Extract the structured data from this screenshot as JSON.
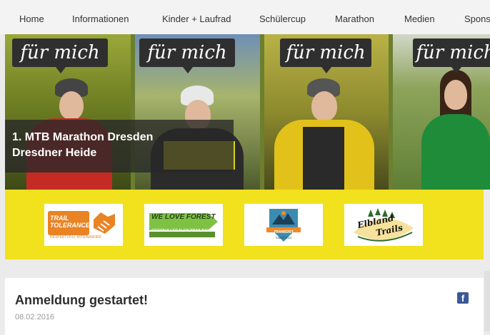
{
  "nav": {
    "items": [
      "Home",
      "Informationen",
      "Kinder + Laufrad",
      "Schülercup",
      "Marathon",
      "Medien",
      "Sponsoren"
    ]
  },
  "hero": {
    "bubble_text": "für mich",
    "caption_line1": "1. MTB Marathon Dresden",
    "caption_line2": "Dresdner Heide"
  },
  "sponsors": {
    "logos": [
      {
        "name": "trail-tolerance-logo",
        "line1": "TRAIL",
        "line2": "TOLERANCE",
        "line3": "RESPEKTVOLL MITEINANDER"
      },
      {
        "name": "we-love-forest-logo",
        "line1": "WE LOVE FOREST",
        "line2": "GEGEN ILLEGALEN TRAILBAU"
      },
      {
        "name": "transost-logo",
        "line1": "TRANSOST",
        "line2": "SINCE 2003"
      },
      {
        "name": "elbland-trails-logo",
        "line1": "Elbland",
        "line2": "Trails"
      }
    ]
  },
  "article": {
    "title": "Anmeldung gestartet!",
    "date": "08.02.2016",
    "fb_glyph": "f"
  }
}
